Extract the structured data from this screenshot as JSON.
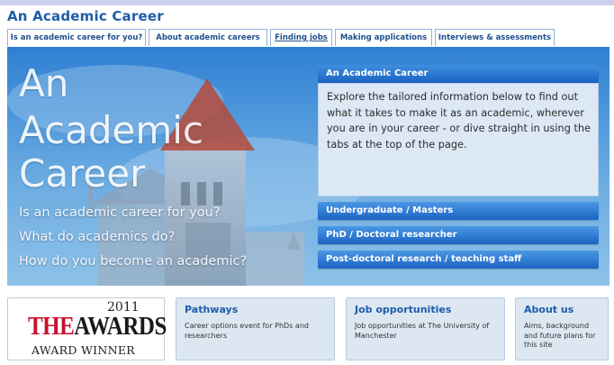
{
  "page": {
    "title": "An Academic Career"
  },
  "tabs": [
    {
      "label": "Is an academic career for you?",
      "active": false
    },
    {
      "label": "About academic careers",
      "active": false
    },
    {
      "label": "Finding jobs",
      "active": true
    },
    {
      "label": "Making applications",
      "active": false
    },
    {
      "label": "Interviews & assessments",
      "active": false
    }
  ],
  "hero": {
    "big_title_lines": [
      "An",
      "Academic",
      "Career"
    ],
    "questions": [
      "Is an academic career for you?",
      "What do academics do?",
      "How do you become an academic?"
    ],
    "info_panel": {
      "header": "An Academic Career",
      "body": "Explore the tailored information below to find out what it takes to make it as an academic, wherever you are in your career - or dive straight in using the tabs at the top of the page."
    },
    "links": [
      "Undergraduate / Masters",
      "PhD / Doctoral researcher",
      "Post-doctoral research / teaching staff"
    ]
  },
  "awards": {
    "year": "2011",
    "the": "THE",
    "main": "AWARDS",
    "sub": "AWARD WINNER"
  },
  "cards": [
    {
      "title": "Pathways",
      "text": "Career options event for PhDs and researchers"
    },
    {
      "title": "Job opportunities",
      "text": "Job opportunities at The University of Manchester"
    },
    {
      "title": "About us",
      "text": "Aims, background and future plans for this site"
    }
  ],
  "colors": {
    "brand_blue": "#1f5ca8",
    "hero_sky": "#4f98dc",
    "awards_red": "#c8102e"
  }
}
